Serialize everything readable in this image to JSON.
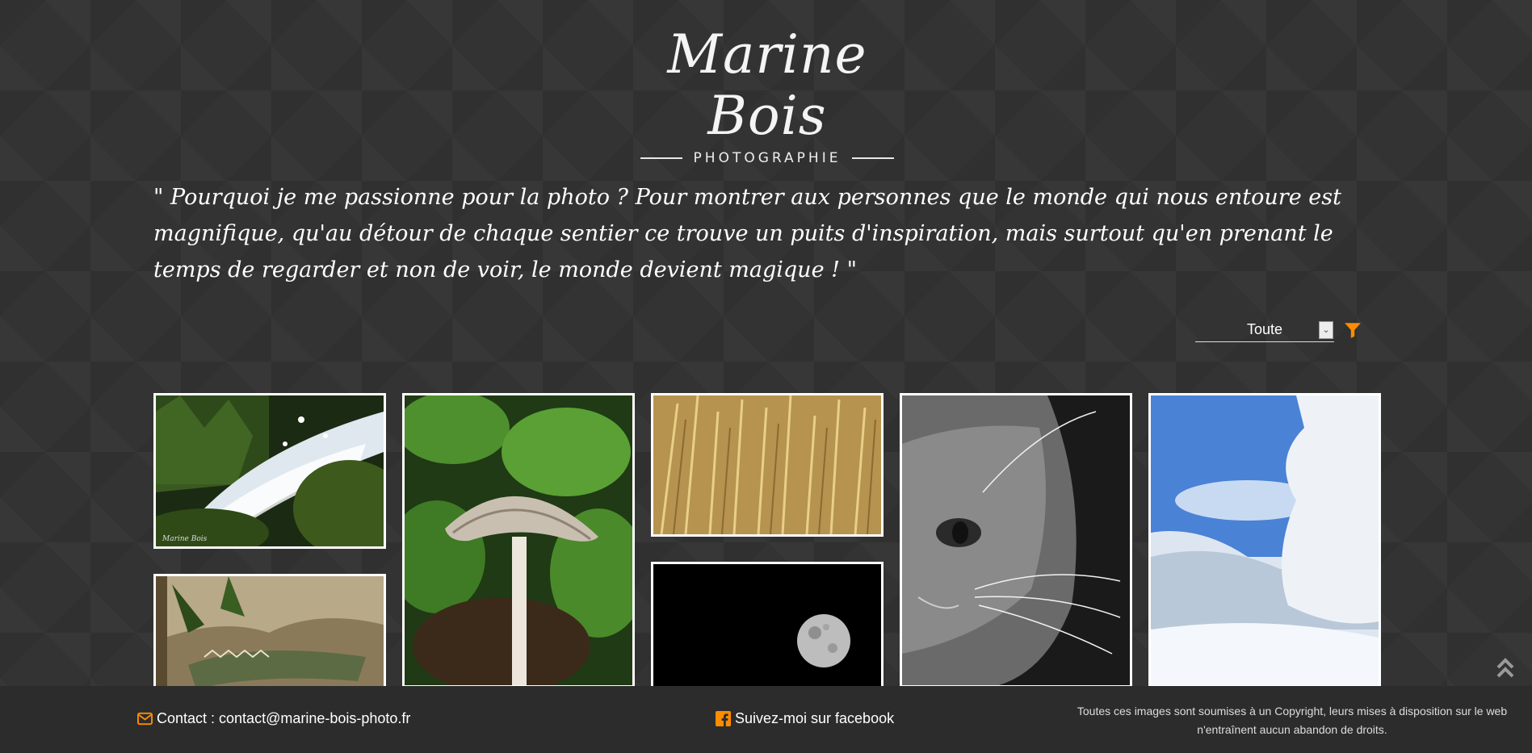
{
  "header": {
    "logo_script": "Marine Bois",
    "logo_subtitle": "PHOTOGRAPHIE"
  },
  "intro": {
    "quote": "\" Pourquoi je me passionne pour la photo ? Pour montrer aux personnes que le monde qui nous entoure est magnifique, qu'au détour de chaque sentier ce trouve un puits d'inspiration, mais surtout qu'en prenant le temps de regarder et non de voir, le monde devient magique ! \""
  },
  "filter": {
    "selected": "Toute",
    "arrow_glyph": "⌄",
    "icon": "filter-icon",
    "accent_color": "#ff8c00"
  },
  "gallery": {
    "photos": [
      {
        "subject": "waterfall-splash",
        "signature": "Marine Bois"
      },
      {
        "subject": "mushroom"
      },
      {
        "subject": "wheat-field"
      },
      {
        "subject": "cat-black-and-white"
      },
      {
        "subject": "snowy-forest"
      },
      {
        "subject": "crocodile"
      },
      {
        "subject": "moon"
      }
    ]
  },
  "footer": {
    "contact": "Contact : contact@marine-bois-photo.fr",
    "contact_icon": "envelope-icon",
    "facebook": "Suivez-moi sur facebook",
    "facebook_icon": "facebook-icon",
    "copyright_line1": "Toutes ces images sont soumises à un Copyright, leurs mises à disposition sur le web",
    "copyright_line2": "n'entraînent aucun abandon de droits.",
    "icon_color": "#ff8c00"
  },
  "back_to_top_icon": "double-chevron-up-icon"
}
